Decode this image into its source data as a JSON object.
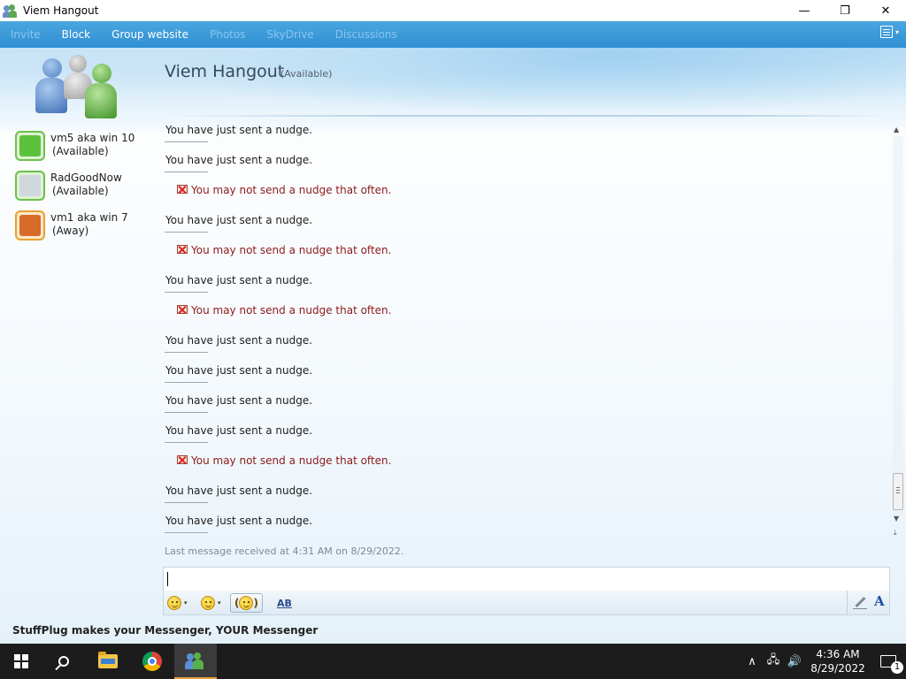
{
  "window": {
    "title": "Viem Hangout",
    "minimize_glyph": "—",
    "maximize_glyph": "❐",
    "close_glyph": "✕"
  },
  "menu": {
    "items": [
      {
        "label": "Invite",
        "enabled": false
      },
      {
        "label": "Block",
        "enabled": true
      },
      {
        "label": "Group website",
        "enabled": true
      },
      {
        "label": "Photos",
        "enabled": false
      },
      {
        "label": "SkyDrive",
        "enabled": false
      },
      {
        "label": "Discussions",
        "enabled": false
      }
    ],
    "right_icon": "menu-list-icon",
    "right_caret": "▾"
  },
  "contacts": [
    {
      "name": "vm5 aka win 10",
      "status": "(Available)",
      "state": "available",
      "avatar_color": "#5cc23c"
    },
    {
      "name": "RadGoodNow",
      "status": "(Available)",
      "state": "available",
      "avatar_color": "#d0d7dc"
    },
    {
      "name": "vm1 aka win 7",
      "status": "(Away)",
      "state": "away",
      "avatar_color": "#d86a2a"
    }
  ],
  "conversation": {
    "title": "Viem Hangout",
    "status": "(Available)",
    "messages": [
      {
        "type": "info",
        "text": "You have just sent a nudge."
      },
      {
        "type": "info",
        "text": "You have just sent a nudge."
      },
      {
        "type": "error",
        "text": "You may not send a nudge that often."
      },
      {
        "type": "info",
        "text": "You have just sent a nudge."
      },
      {
        "type": "error",
        "text": "You may not send a nudge that often."
      },
      {
        "type": "info",
        "text": "You have just sent a nudge."
      },
      {
        "type": "error",
        "text": "You may not send a nudge that often."
      },
      {
        "type": "info",
        "text": "You have just sent a nudge."
      },
      {
        "type": "info",
        "text": "You have just sent a nudge."
      },
      {
        "type": "info",
        "text": "You have just sent a nudge."
      },
      {
        "type": "info",
        "text": "You have just sent a nudge."
      },
      {
        "type": "error",
        "text": "You may not send a nudge that often."
      },
      {
        "type": "info",
        "text": "You have just sent a nudge."
      },
      {
        "type": "info",
        "text": "You have just sent a nudge."
      }
    ],
    "last_received": "Last message received at 4:31 AM on 8/29/2022."
  },
  "input": {
    "value": ""
  },
  "toolbar": {
    "emoticon_icon": "emoticon-icon",
    "wink_icon": "wink-icon",
    "nudge_icon": "nudge-icon",
    "spellcheck_label": "AB",
    "font_label": "A"
  },
  "banner": {
    "text": "StuffPlug makes your Messenger, YOUR Messenger"
  },
  "taskbar": {
    "clock_time": "4:36 AM",
    "clock_date": "8/29/2022",
    "notification_count": "1",
    "tray_glyphs": {
      "chevron": "∧",
      "network": "🖧",
      "volume": "🔊"
    }
  }
}
